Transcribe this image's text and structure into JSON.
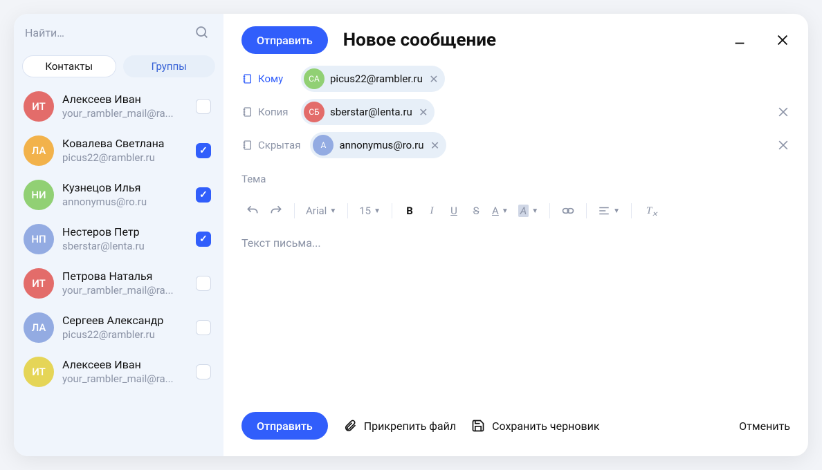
{
  "search": {
    "placeholder": "Найти…"
  },
  "tabs": {
    "contacts": "Контакты",
    "groups": "Группы"
  },
  "avatarColors": {
    "red": "#e36c6a",
    "orange": "#f2b24b",
    "green": "#91d074",
    "blue": "#93abe2",
    "yellow": "#e5d557"
  },
  "contacts": [
    {
      "initials": "ИТ",
      "name": "Алексеев Иван",
      "email": "your_rambler_mail@ra...",
      "color": "red",
      "checked": false
    },
    {
      "initials": "ЛА",
      "name": "Ковалева Светлана",
      "email": "picus22@rambler.ru",
      "color": "orange",
      "checked": true
    },
    {
      "initials": "НИ",
      "name": "Кузнецов Илья",
      "email": "annonymus@ro.ru",
      "color": "green",
      "checked": true
    },
    {
      "initials": "НП",
      "name": "Нестеров Петр",
      "email": "sberstar@lenta.ru",
      "color": "blue",
      "checked": true
    },
    {
      "initials": "ИТ",
      "name": "Петрова Наталья",
      "email": "your_rambler_mail@ra...",
      "color": "red",
      "checked": false
    },
    {
      "initials": "ЛА",
      "name": "Сергеев Александр",
      "email": "picus22@rambler.ru",
      "color": "blue",
      "checked": false
    },
    {
      "initials": "ИТ",
      "name": "Алексеев Иван",
      "email": "your_rambler_mail@ra...",
      "color": "yellow",
      "checked": false
    }
  ],
  "header": {
    "send": "Отправить",
    "title": "Новое сообщение"
  },
  "recipients": {
    "to": {
      "label": "Кому",
      "chip": {
        "initials": "СА",
        "email": "picus22@rambler.ru",
        "color": "green"
      }
    },
    "cc": {
      "label": "Копия",
      "chip": {
        "initials": "СБ",
        "email": "sberstar@lenta.ru",
        "color": "red"
      }
    },
    "bcc": {
      "label": "Скрытая",
      "chip": {
        "initials": "А",
        "email": "annonymus@ro.ru",
        "color": "blue"
      }
    }
  },
  "subject": {
    "placeholder": "Тема"
  },
  "toolbar": {
    "font": "Arial",
    "size": "15"
  },
  "body": {
    "placeholder": "Текст письма..."
  },
  "footer": {
    "send": "Отправить",
    "attach": "Прикрепить файл",
    "draft": "Сохранить черновик",
    "cancel": "Отменить"
  }
}
